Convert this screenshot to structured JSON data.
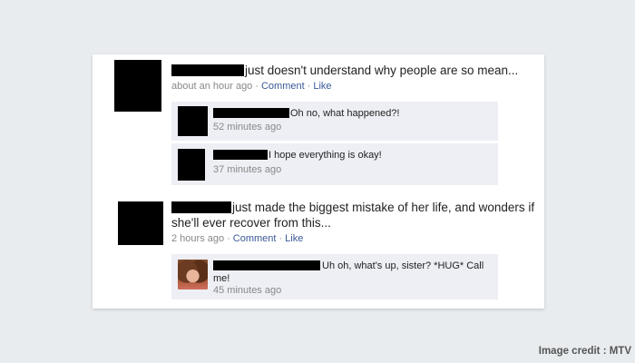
{
  "posts": [
    {
      "text": "just doesn't understand why people are so mean...",
      "time": "about an hour ago",
      "comment_link": "Comment",
      "like_link": "Like",
      "separator": "·",
      "comments": [
        {
          "text": "Oh no, what happened?!",
          "time": "52 minutes ago"
        },
        {
          "text": "I hope everything is okay!",
          "time": "37 minutes ago"
        }
      ]
    },
    {
      "text": "just made the biggest mistake of her life, and wonders if she'll ever recover from this...",
      "time": "2 hours ago",
      "comment_link": "Comment",
      "like_link": "Like",
      "separator": "·",
      "comments": [
        {
          "text": "Uh oh, what's up, sister? *HUG* Call me!",
          "time": "45 minutes ago"
        }
      ]
    }
  ],
  "image_credit": "Image credit : MTV"
}
